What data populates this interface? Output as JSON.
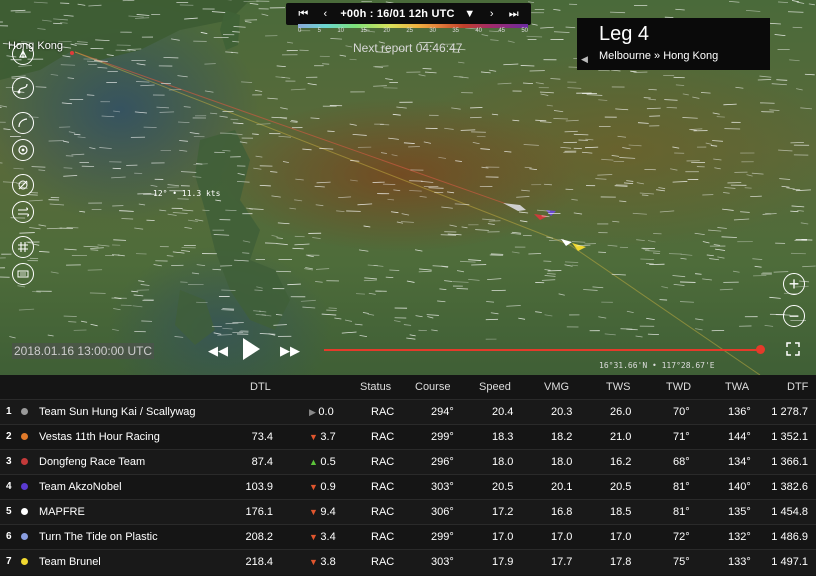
{
  "time_control": {
    "label": "+00h : 16/01 12h UTC",
    "scale_ticks": [
      "0",
      "5",
      "10",
      "15",
      "20",
      "25",
      "30",
      "35",
      "40",
      "45",
      "50"
    ]
  },
  "next_report": "Next report 04:46:47",
  "leg": {
    "title": "Leg 4",
    "route": "Melbourne » Hong Kong"
  },
  "map": {
    "place_label": "Hong Kong",
    "wind_readout": "12° • 11.3 kts",
    "coordinates": "16°31.66'N • 117°28.67'E",
    "timestamp": "2018.01.16 13:00:00 UTC",
    "timeline_progress": 0.99
  },
  "tools": [
    "boat-icon",
    "route-icon",
    "measure-icon",
    "compass-icon",
    "layers-off-icon",
    "wind-icon",
    "grid-icon",
    "keyboard-icon"
  ],
  "table": {
    "headers": {
      "dtl": "DTL",
      "status": "Status",
      "course": "Course",
      "speed": "Speed",
      "vmg": "VMG",
      "tws": "TWS",
      "twd": "TWD",
      "twa": "TWA",
      "dtf": "DTF"
    },
    "rows": [
      {
        "rank": "1",
        "color": "#9a9a9a",
        "name": "Team Sun Hung Kai / Scallywag",
        "dtl": "",
        "trend": "none",
        "delta": "0.0",
        "status": "RAC",
        "course": "294°",
        "speed": "20.4",
        "vmg": "20.3",
        "tws": "26.0",
        "twd": "70°",
        "twa": "136°",
        "dtf": "1 278.7"
      },
      {
        "rank": "2",
        "color": "#e07a2a",
        "name": "Vestas 11th Hour Racing",
        "dtl": "73.4",
        "trend": "down",
        "delta": "3.7",
        "status": "RAC",
        "course": "299°",
        "speed": "18.3",
        "vmg": "18.2",
        "tws": "21.0",
        "twd": "71°",
        "twa": "144°",
        "dtf": "1 352.1"
      },
      {
        "rank": "3",
        "color": "#c43a3a",
        "name": "Dongfeng Race Team",
        "dtl": "87.4",
        "trend": "up",
        "delta": "0.5",
        "status": "RAC",
        "course": "296°",
        "speed": "18.0",
        "vmg": "18.0",
        "tws": "16.2",
        "twd": "68°",
        "twa": "134°",
        "dtf": "1 366.1"
      },
      {
        "rank": "4",
        "color": "#5a3ad0",
        "name": "Team AkzoNobel",
        "dtl": "103.9",
        "trend": "down",
        "delta": "0.9",
        "status": "RAC",
        "course": "303°",
        "speed": "20.5",
        "vmg": "20.1",
        "tws": "20.5",
        "twd": "81°",
        "twa": "140°",
        "dtf": "1 382.6"
      },
      {
        "rank": "5",
        "color": "#ffffff",
        "name": "MAPFRE",
        "dtl": "176.1",
        "trend": "down",
        "delta": "9.4",
        "status": "RAC",
        "course": "306°",
        "speed": "17.2",
        "vmg": "16.8",
        "tws": "18.5",
        "twd": "81°",
        "twa": "135°",
        "dtf": "1 454.8"
      },
      {
        "rank": "6",
        "color": "#8a9ee0",
        "name": "Turn The Tide on Plastic",
        "dtl": "208.2",
        "trend": "down",
        "delta": "3.4",
        "status": "RAC",
        "course": "299°",
        "speed": "17.0",
        "vmg": "17.0",
        "tws": "17.0",
        "twd": "72°",
        "twa": "132°",
        "dtf": "1 486.9"
      },
      {
        "rank": "7",
        "color": "#f0d830",
        "name": "Team Brunel",
        "dtl": "218.4",
        "trend": "down",
        "delta": "3.8",
        "status": "RAC",
        "course": "303°",
        "speed": "17.9",
        "vmg": "17.7",
        "tws": "17.8",
        "twd": "75°",
        "twa": "133°",
        "dtf": "1 497.1"
      }
    ]
  }
}
